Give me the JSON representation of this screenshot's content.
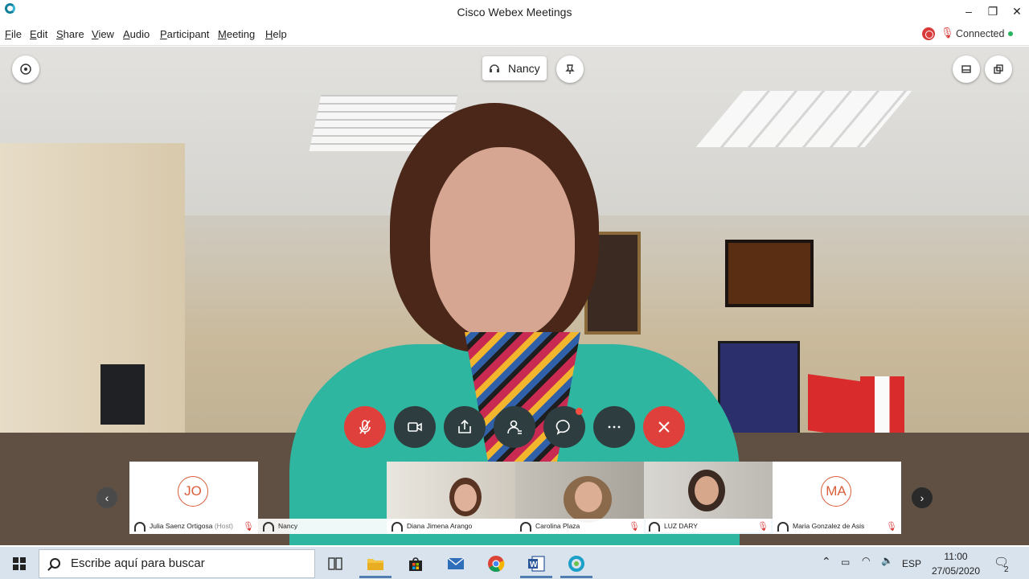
{
  "window": {
    "title": "Cisco Webex Meetings",
    "controls": [
      "minimize-icon",
      "restore-icon",
      "close-icon"
    ]
  },
  "menu": {
    "items": [
      "File",
      "Edit",
      "Share",
      "View",
      "Audio",
      "Participant",
      "Meeting",
      "Help"
    ]
  },
  "status": {
    "recording_icon": "record-icon",
    "mute_icon": "mic-muted-icon",
    "connection_text": "Connected",
    "connection_color": "#25b35b"
  },
  "stage": {
    "active_speaker": "Nancy",
    "speaker_icon": "headset-icon",
    "left_icon": "info-icon",
    "lock_icon": "pin-icon",
    "right_icons": [
      "layout-icon",
      "popout-icon"
    ]
  },
  "controls": [
    {
      "name": "mute-button",
      "icon": "mic-muted-icon",
      "color": "#e0403b"
    },
    {
      "name": "video-button",
      "icon": "video-camera-icon",
      "color": "#2e3d3f"
    },
    {
      "name": "share-button",
      "icon": "share-icon",
      "color": "#2e3d3f"
    },
    {
      "name": "participants-button",
      "icon": "participants-icon",
      "color": "#2e3d3f"
    },
    {
      "name": "chat-button",
      "icon": "chat-icon",
      "color": "#2e3d3f"
    },
    {
      "name": "more-button",
      "icon": "more-icon",
      "color": "#2e3d3f"
    },
    {
      "name": "leave-button",
      "icon": "close-icon",
      "color": "#e0403b"
    }
  ],
  "participants": [
    {
      "name": "Julia Saenz Ortigosa",
      "suffix": "(Host)",
      "initials": "JO",
      "video": false,
      "muted": true
    },
    {
      "name": "Nancy",
      "video": true,
      "muted": false
    },
    {
      "name": "Diana Jimena Arango",
      "video": true,
      "muted": false
    },
    {
      "name": "Carolina Plaza",
      "video": true,
      "muted": true
    },
    {
      "name": "LUZ DARY",
      "video": true,
      "muted": true,
      "active": true
    },
    {
      "name": "Maria Gonzalez de Asis",
      "initials": "MA",
      "video": false,
      "muted": true
    }
  ],
  "taskbar": {
    "search_placeholder": "Escribe aquí para buscar",
    "apps": [
      "task-view-icon",
      "file-explorer-icon",
      "store-icon",
      "mail-icon",
      "chrome-icon",
      "word-icon",
      "webex-icon"
    ],
    "language": "ESP",
    "time": "11:00",
    "date": "27/05/2020",
    "notification_count": "2"
  }
}
